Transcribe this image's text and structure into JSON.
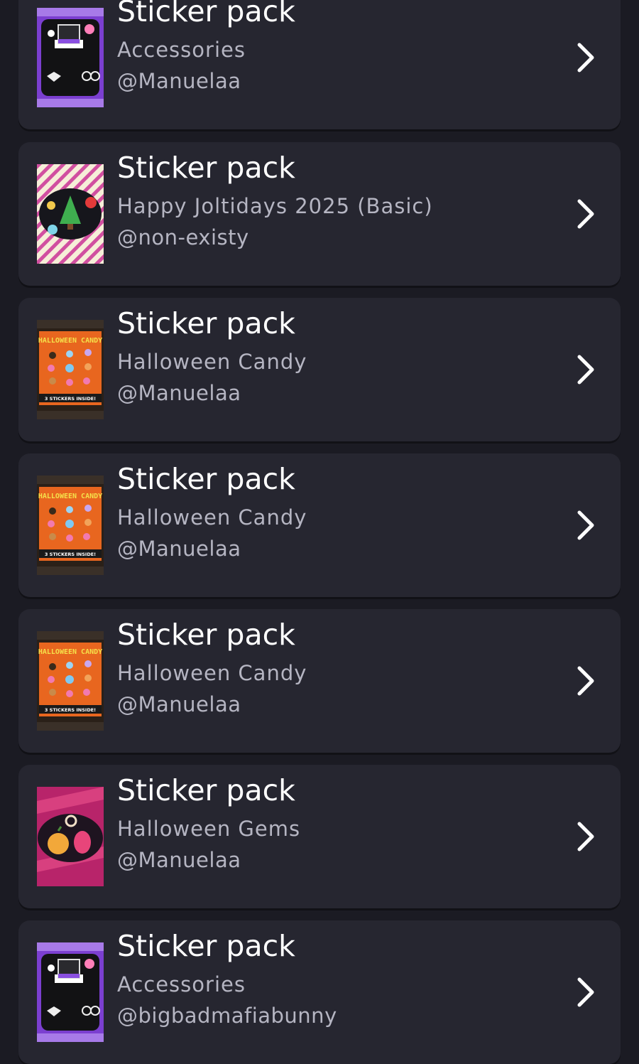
{
  "colors": {
    "background": "#1b1b23",
    "card": "#262630",
    "title": "#ffffff",
    "subtext": "#b5b5c2"
  },
  "items": [
    {
      "title": "Sticker pack",
      "subtitle": "Accessories",
      "author": "@Manuelaa",
      "thumb": "accessories-pack-icon"
    },
    {
      "title": "Sticker pack",
      "subtitle": "Happy Joltidays 2025 (Basic)",
      "author": "@non-existy",
      "thumb": "joltidays-pack-icon"
    },
    {
      "title": "Sticker pack",
      "subtitle": "Halloween Candy",
      "author": "@Manuelaa",
      "thumb": "halloween-candy-pack-icon",
      "thumb_text": [
        "HALLOWEEN CANDY",
        "3 STICKERS INSIDE!"
      ]
    },
    {
      "title": "Sticker pack",
      "subtitle": "Halloween Candy",
      "author": "@Manuelaa",
      "thumb": "halloween-candy-pack-icon",
      "thumb_text": [
        "HALLOWEEN CANDY",
        "3 STICKERS INSIDE!"
      ]
    },
    {
      "title": "Sticker pack",
      "subtitle": "Halloween Candy",
      "author": "@Manuelaa",
      "thumb": "halloween-candy-pack-icon",
      "thumb_text": [
        "HALLOWEEN CANDY",
        "3 STICKERS INSIDE!"
      ]
    },
    {
      "title": "Sticker pack",
      "subtitle": "Halloween Gems",
      "author": "@Manuelaa",
      "thumb": "halloween-gems-pack-icon"
    },
    {
      "title": "Sticker pack",
      "subtitle": "Accessories",
      "author": "@bigbadmafiabunny",
      "thumb": "accessories-pack-icon"
    }
  ]
}
